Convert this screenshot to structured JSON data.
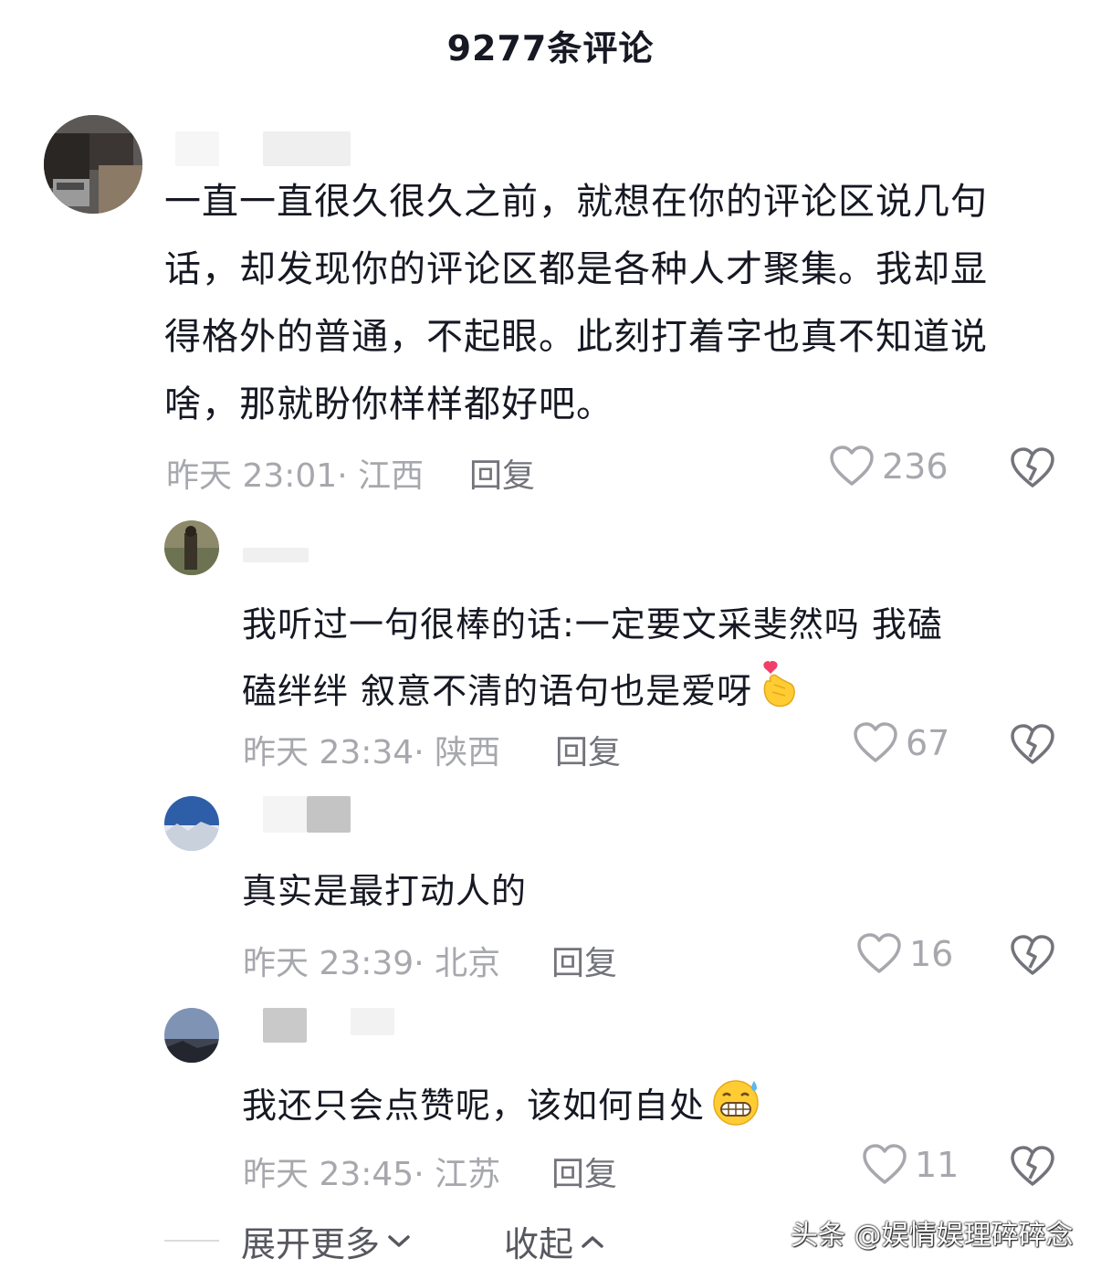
{
  "header": {
    "title": "9277条评论"
  },
  "comments": [
    {
      "text_lines": [
        "一直一直很久很久之前，就想在你的评论区说几句",
        "话，却发现你的评论区都是各种人才聚集。我却显",
        "得格外的普通，不起眼。此刻打着字也真不知道说",
        "啥，那就盼你样样都好吧。"
      ],
      "meta": "昨天 23:01· 江西",
      "reply_label": "回复",
      "likes": "236"
    }
  ],
  "replies": [
    {
      "text_lines": [
        "我听过一句很棒的话:一定要文采斐然吗 我磕",
        "磕绊绊 叙意不清的语句也是爱呀"
      ],
      "emoji": "finger-heart-emoji",
      "meta": "昨天 23:34· 陕西",
      "reply_label": "回复",
      "likes": "67"
    },
    {
      "text_lines": [
        "真实是最打动人的"
      ],
      "meta": "昨天 23:39· 北京",
      "reply_label": "回复",
      "likes": "16"
    },
    {
      "text_lines": [
        "我还只会点赞呢，该如何自处"
      ],
      "emoji": "grimacing-sweat-emoji",
      "meta": "昨天 23:45· 江苏",
      "reply_label": "回复",
      "likes": "11"
    }
  ],
  "footer": {
    "expand_label": "展开更多",
    "collapse_label": "收起"
  },
  "watermark": "头条 @娱情娱理碎碎念",
  "colors": {
    "text": "#161823",
    "meta": "#a7a8ad",
    "icon": "#73747b"
  }
}
